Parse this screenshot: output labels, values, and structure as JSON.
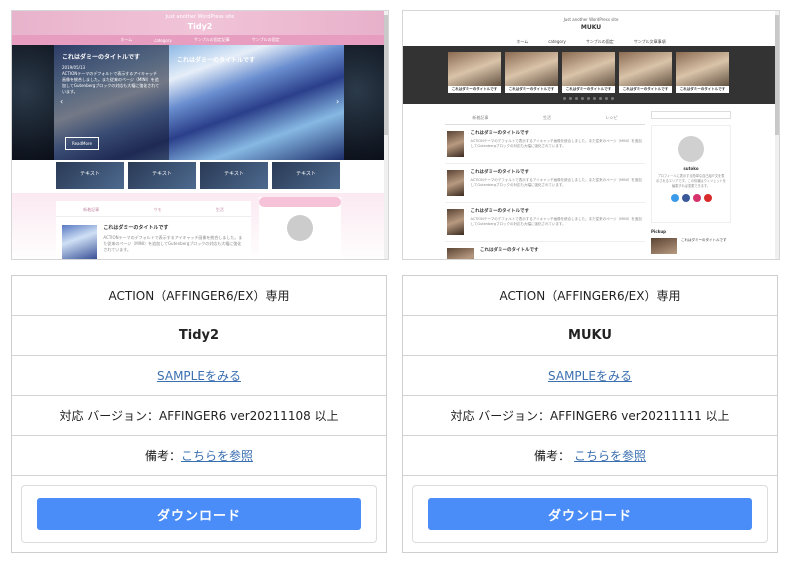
{
  "themes": [
    {
      "compat_label": "ACTION（AFFINGER6/EX）専用",
      "name": "Tidy2",
      "sample_link": "SAMPLEをみる",
      "version": "対応 バージョン：AFFINGER6 ver20211108 以上",
      "note_label": "備考：",
      "note_link": "こちらを参照",
      "download_label": "ダウンロード",
      "preview": {
        "site_tagline": "Just another WordPress site",
        "site_name": "Tidy2",
        "nav": [
          "ホーム",
          "category",
          "サンプルの固定記事",
          "サンプルの固定"
        ],
        "hero_title": "これはダミーのタイトルです",
        "hero_meta": "2019/05/13",
        "hero_text": "ACTIONテーマのデフォルトで表示するアイキャッチ画像を統合しました。また従来のページ（MINI）を追加してGutenbergブロックの対応も大幅に強化されています。",
        "hero_title_2": "これはダミーのタイトルです",
        "read_more": "ReadMore",
        "thumb_label": "テキスト",
        "tabs": [
          "新着記事",
          "ウモ",
          "生活"
        ],
        "post_title": "これはダミーのタイトルです",
        "post_text": "ACTIONテーマのデフォルトで表示するアイキャッチ画像を統合しました。また従来のページ（MINI）を追加してGutenbergブロックの対応も大幅に強化されています。"
      }
    },
    {
      "compat_label": "ACTION（AFFINGER6/EX）専用",
      "name": "MUKU",
      "sample_link": "SAMPLEをみる",
      "version": "対応 バージョン：AFFINGER6 ver20211111 以上",
      "note_label": "備考：",
      "note_link": "こちらを参照",
      "download_label": "ダウンロード",
      "preview": {
        "site_tagline": "Just another WordPress site",
        "site_name": "MUKU",
        "nav": [
          "ホーム",
          "category",
          "サンプルの固定",
          "サンプル文章事項"
        ],
        "slide_label": "これはダミーのタイトルです",
        "tabs": [
          "新着記事",
          "生活",
          "レシピ"
        ],
        "post_title": "これはダミーのタイトルです",
        "post_text": "ACTIONテーマのデフォルトで表示するアイキャッチ画像を統合しました。また従来のページ（MINI）を追加してGutenbergブロックの対応も大幅に強化されています。",
        "profile_name": "sutoko",
        "profile_text": "プロフィールに表示する簡単な自己紹介文を表示されるエリアです。この情報はウィジェットを編集すれば変更できます。",
        "pickup_label": "Pickup",
        "pickup_title": "これはダミーのタイトルです"
      }
    }
  ],
  "colors": {
    "download_button": "#4b8df8",
    "link": "#3a6fb0",
    "tidy_header": "#f1c4d8",
    "muku_slider_bg": "#333333"
  }
}
